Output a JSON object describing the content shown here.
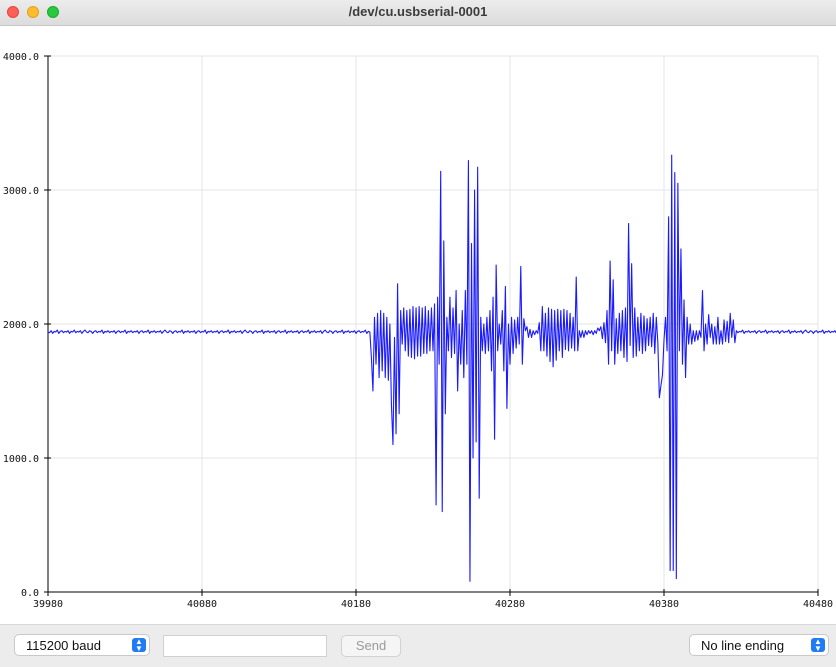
{
  "window": {
    "title": "/dev/cu.usbserial-0001"
  },
  "toolbar": {
    "baud_label": "115200 baud",
    "message_value": "",
    "send_label": "Send",
    "line_ending_label": "No line ending"
  },
  "colors": {
    "series": "#1a1aff",
    "grid": "#e6e6e6",
    "axis": "#000000"
  },
  "icons": {
    "stepper": "up-down-chevrons-icon"
  },
  "chart_data": {
    "type": "line",
    "title": "",
    "xlabel": "",
    "ylabel": "",
    "xlim": [
      39980,
      40480
    ],
    "ylim": [
      0,
      4000
    ],
    "x_ticks": [
      39980,
      40080,
      40180,
      40280,
      40380,
      40480
    ],
    "y_ticks": [
      "0.0",
      "1000.0",
      "2000.0",
      "3000.0",
      "4000.0"
    ],
    "grid": true,
    "legend": "none",
    "series": [
      {
        "x_start": 39980,
        "x_step": 1,
        "values": [
          1940,
          1935,
          1950,
          1930,
          1945,
          1940,
          1955,
          1930,
          1945,
          1950,
          1935,
          1945,
          1940,
          1950,
          1930,
          1945,
          1940,
          1955,
          1935,
          1945,
          1940,
          1950,
          1930,
          1945,
          1955,
          1940,
          1935,
          1950,
          1945,
          1930,
          1945,
          1950,
          1935,
          1945,
          1940,
          1955,
          1930,
          1945,
          1940,
          1950,
          1935,
          1945,
          1940,
          1950,
          1930,
          1945,
          1950,
          1935,
          1945,
          1940,
          1955,
          1930,
          1945,
          1940,
          1950,
          1935,
          1945,
          1940,
          1950,
          1930,
          1945,
          1950,
          1935,
          1945,
          1940,
          1955,
          1930,
          1945,
          1940,
          1950,
          1935,
          1945,
          1940,
          1950,
          1930,
          1945,
          1955,
          1940,
          1935,
          1950,
          1945,
          1930,
          1945,
          1950,
          1935,
          1945,
          1940,
          1955,
          1930,
          1945,
          1940,
          1950,
          1935,
          1945,
          1940,
          1950,
          1930,
          1945,
          1950,
          1935,
          1945,
          1940,
          1955,
          1930,
          1945,
          1940,
          1950,
          1935,
          1945,
          1940,
          1950,
          1930,
          1945,
          1950,
          1935,
          1945,
          1940,
          1955,
          1930,
          1945,
          1940,
          1950,
          1935,
          1945,
          1940,
          1950,
          1930,
          1945,
          1955,
          1940,
          1935,
          1950,
          1945,
          1930,
          1945,
          1950,
          1935,
          1945,
          1940,
          1955,
          1930,
          1945,
          1940,
          1950,
          1935,
          1945,
          1940,
          1950,
          1930,
          1945,
          1950,
          1935,
          1945,
          1940,
          1955,
          1930,
          1945,
          1940,
          1950,
          1935,
          1945,
          1940,
          1950,
          1930,
          1945,
          1950,
          1935,
          1945,
          1940,
          1955,
          1930,
          1945,
          1940,
          1950,
          1935,
          1945,
          1940,
          1950,
          1930,
          1945,
          1955,
          1940,
          1935,
          1950,
          1945,
          1930,
          1945,
          1950,
          1935,
          1945,
          1940,
          1955,
          1930,
          1945,
          1940,
          1950,
          1935,
          1945,
          1940,
          1950,
          1930,
          1945,
          1950,
          1935,
          1945,
          1940,
          1955,
          1930,
          1945,
          1940,
          1950,
          1935,
          1945,
          1940,
          1950,
          1930,
          1945,
          1950,
          1935,
          1945,
          1940,
          1955,
          1930,
          1945,
          1940,
          1950,
          1935,
          1945,
          1940,
          1950,
          1930,
          1945,
          1955,
          1940,
          1935,
          1950,
          1945,
          1930,
          1945,
          1950,
          1935,
          1945,
          1940,
          1955,
          1930,
          1945,
          1940,
          1950,
          1935,
          1945,
          1940,
          1950,
          1930,
          1945,
          1950,
          1935,
          1945,
          1940,
          1955,
          1930,
          1945,
          1940,
          1950,
          1935,
          1945,
          1940,
          1950,
          1930,
          1945,
          1950,
          1935,
          1945,
          1940,
          1955,
          1930,
          1945,
          1940,
          1950,
          1935,
          1945,
          1940,
          1950,
          1930,
          1945,
          1955,
          1940,
          1935,
          1950,
          1945,
          1930,
          1945,
          1950,
          1935,
          1945,
          1940,
          1955,
          1930,
          1945,
          1940,
          1950,
          1935,
          1945,
          1940,
          1950,
          1930,
          1945,
          1950,
          1935,
          1945,
          1940,
          1955,
          1930,
          1945,
          1940,
          1950,
          1935,
          1945,
          1940,
          1950,
          1930,
          1945,
          1950,
          1935,
          1945,
          1940,
          1955,
          1930,
          1945,
          1940,
          1950,
          1935,
          1945,
          1940,
          1950,
          1930,
          1945,
          1955,
          1940,
          1935,
          1950,
          1945,
          1930,
          1945,
          1950,
          1935,
          1945,
          1940,
          1955,
          1930,
          1945,
          1940,
          1950,
          1935,
          1945,
          1940,
          1950,
          1930,
          1945,
          1950,
          1935,
          1945,
          1940,
          1955,
          1930,
          1945,
          1940,
          1950,
          1935,
          1945,
          1940,
          1950,
          1930,
          1945,
          1950,
          1935,
          1945,
          1940,
          1955,
          1930,
          1945,
          1940,
          1950,
          1935,
          1945,
          1940,
          1950,
          1930,
          1945,
          1955,
          1940,
          1935,
          1950,
          1945,
          1930,
          1945,
          1950,
          1935,
          1945,
          1940,
          1955,
          1930,
          1945,
          1940,
          1950,
          1935,
          1945,
          1940,
          1950,
          1930,
          1945,
          1950,
          1935,
          1945,
          1940,
          1955,
          1930,
          1945,
          1940,
          1950,
          1935,
          1945,
          1940,
          1950,
          1930,
          1945,
          1950,
          1935,
          1945,
          1940,
          1955,
          1930,
          1945,
          1940,
          1950,
          1935,
          1945,
          1940,
          1950,
          1930,
          1945,
          1955,
          1940,
          1935,
          1950,
          1945,
          1930,
          1945,
          1950,
          1935,
          1945,
          1940,
          1955,
          1930,
          1945,
          1940,
          1950,
          1935,
          1945,
          1940,
          1950,
          1930,
          1945,
          1950,
          1935,
          1945,
          1940,
          1955,
          1930,
          1945,
          1940,
          1950,
          1935,
          1945,
          1940,
          1950,
          1930,
          1945,
          1950,
          1935,
          1945,
          1940,
          1955,
          1930,
          1945,
          1940,
          1950,
          1935,
          1945,
          1940,
          1950,
          1930,
          1945,
          1955,
          1940,
          1935,
          1950,
          1945,
          1930,
          1945,
          1950,
          1935,
          1945,
          1940,
          1955,
          1930,
          1945,
          1940,
          1950,
          1935,
          1945,
          1940,
          1950,
          1930,
          1945,
          1950,
          1935,
          1945,
          1940,
          1955,
          1930,
          1945
        ]
      }
    ],
    "overrides": [
      [
        40190,
        1750
      ],
      [
        40191,
        1500
      ],
      [
        40192,
        2050
      ],
      [
        40193,
        1700
      ],
      [
        40194,
        2080
      ],
      [
        40195,
        1600
      ],
      [
        40196,
        2100
      ],
      [
        40197,
        1650
      ],
      [
        40198,
        2080
      ],
      [
        40199,
        1600
      ],
      [
        40200,
        2050
      ],
      [
        40201,
        1580
      ],
      [
        40202,
        2000
      ],
      [
        40203,
        1400
      ],
      [
        40204,
        1100
      ],
      [
        40205,
        1900
      ],
      [
        40206,
        1180
      ],
      [
        40207,
        2300
      ],
      [
        40208,
        1330
      ],
      [
        40209,
        2100
      ],
      [
        40210,
        1850
      ],
      [
        40211,
        2120
      ],
      [
        40212,
        1800
      ],
      [
        40213,
        2100
      ],
      [
        40214,
        1760
      ],
      [
        40215,
        2110
      ],
      [
        40216,
        1750
      ],
      [
        40217,
        2130
      ],
      [
        40218,
        1740
      ],
      [
        40219,
        2120
      ],
      [
        40220,
        1760
      ],
      [
        40221,
        2130
      ],
      [
        40222,
        1760
      ],
      [
        40223,
        2120
      ],
      [
        40224,
        1780
      ],
      [
        40225,
        2130
      ],
      [
        40226,
        1780
      ],
      [
        40227,
        2100
      ],
      [
        40228,
        1800
      ],
      [
        40229,
        2120
      ],
      [
        40230,
        1800
      ],
      [
        40231,
        2150
      ],
      [
        40232,
        650
      ],
      [
        40233,
        2200
      ],
      [
        40234,
        1700
      ],
      [
        40235,
        3140
      ],
      [
        40236,
        600
      ],
      [
        40237,
        2620
      ],
      [
        40238,
        1330
      ],
      [
        40239,
        2050
      ],
      [
        40240,
        1800
      ],
      [
        40241,
        2200
      ],
      [
        40242,
        1750
      ],
      [
        40243,
        2120
      ],
      [
        40244,
        1780
      ],
      [
        40245,
        2250
      ],
      [
        40246,
        1500
      ],
      [
        40247,
        2000
      ],
      [
        40248,
        1700
      ],
      [
        40249,
        2100
      ],
      [
        40250,
        1600
      ],
      [
        40251,
        2250
      ],
      [
        40252,
        1700
      ],
      [
        40253,
        3220
      ],
      [
        40254,
        80
      ],
      [
        40255,
        2600
      ],
      [
        40256,
        1000
      ],
      [
        40257,
        3000
      ],
      [
        40258,
        1120
      ],
      [
        40259,
        3170
      ],
      [
        40260,
        700
      ],
      [
        40261,
        2050
      ],
      [
        40262,
        1800
      ],
      [
        40263,
        2000
      ],
      [
        40264,
        1780
      ],
      [
        40265,
        2050
      ],
      [
        40266,
        1800
      ],
      [
        40267,
        2100
      ],
      [
        40268,
        1650
      ],
      [
        40269,
        2200
      ],
      [
        40270,
        1140
      ],
      [
        40271,
        2440
      ],
      [
        40272,
        1800
      ],
      [
        40273,
        2000
      ],
      [
        40274,
        1850
      ],
      [
        40275,
        2100
      ],
      [
        40276,
        1650
      ],
      [
        40277,
        2280
      ],
      [
        40278,
        1370
      ],
      [
        40279,
        2000
      ],
      [
        40280,
        1700
      ],
      [
        40281,
        2050
      ],
      [
        40282,
        1780
      ],
      [
        40283,
        2030
      ],
      [
        40284,
        1820
      ],
      [
        40285,
        2050
      ],
      [
        40286,
        1850
      ],
      [
        40287,
        2430
      ],
      [
        40288,
        1700
      ],
      [
        40289,
        2040
      ],
      [
        40290,
        1950
      ],
      [
        40291,
        1980
      ],
      [
        40292,
        1900
      ],
      [
        40293,
        1960
      ],
      [
        40294,
        1900
      ],
      [
        40295,
        1950
      ],
      [
        40296,
        1920
      ],
      [
        40297,
        1950
      ],
      [
        40298,
        1930
      ],
      [
        40299,
        2010
      ],
      [
        40300,
        1800
      ],
      [
        40301,
        2130
      ],
      [
        40302,
        1800
      ],
      [
        40303,
        2080
      ],
      [
        40304,
        1760
      ],
      [
        40305,
        2120
      ],
      [
        40306,
        1720
      ],
      [
        40307,
        2110
      ],
      [
        40308,
        1680
      ],
      [
        40309,
        2100
      ],
      [
        40310,
        1730
      ],
      [
        40311,
        2110
      ],
      [
        40312,
        1800
      ],
      [
        40313,
        2100
      ],
      [
        40314,
        1750
      ],
      [
        40315,
        2110
      ],
      [
        40316,
        1810
      ],
      [
        40317,
        2100
      ],
      [
        40318,
        1800
      ],
      [
        40319,
        2080
      ],
      [
        40320,
        1820
      ],
      [
        40321,
        2050
      ],
      [
        40322,
        1800
      ],
      [
        40323,
        2350
      ],
      [
        40324,
        1800
      ],
      [
        40325,
        1950
      ],
      [
        40326,
        1900
      ],
      [
        40327,
        1950
      ],
      [
        40328,
        1900
      ],
      [
        40329,
        1950
      ],
      [
        40330,
        1920
      ],
      [
        40331,
        1950
      ],
      [
        40332,
        1930
      ],
      [
        40333,
        1950
      ],
      [
        40334,
        1920
      ],
      [
        40335,
        1950
      ],
      [
        40336,
        1930
      ],
      [
        40337,
        1970
      ],
      [
        40338,
        1950
      ],
      [
        40339,
        1980
      ],
      [
        40340,
        1890
      ],
      [
        40341,
        2010
      ],
      [
        40342,
        1860
      ],
      [
        40343,
        2100
      ],
      [
        40344,
        1700
      ],
      [
        40345,
        2470
      ],
      [
        40346,
        1800
      ],
      [
        40347,
        2330
      ],
      [
        40348,
        1700
      ],
      [
        40349,
        2040
      ],
      [
        40350,
        1780
      ],
      [
        40351,
        2080
      ],
      [
        40352,
        1800
      ],
      [
        40353,
        2100
      ],
      [
        40354,
        1750
      ],
      [
        40355,
        2120
      ],
      [
        40356,
        1720
      ],
      [
        40357,
        2750
      ],
      [
        40358,
        1840
      ],
      [
        40359,
        2450
      ],
      [
        40360,
        1750
      ],
      [
        40361,
        2120
      ],
      [
        40362,
        1760
      ],
      [
        40363,
        2050
      ],
      [
        40364,
        1800
      ],
      [
        40365,
        2080
      ],
      [
        40366,
        1780
      ],
      [
        40367,
        2060
      ],
      [
        40368,
        1800
      ],
      [
        40369,
        2040
      ],
      [
        40370,
        1840
      ],
      [
        40371,
        2050
      ],
      [
        40372,
        1830
      ],
      [
        40373,
        2080
      ],
      [
        40374,
        1780
      ],
      [
        40375,
        2050
      ],
      [
        40376,
        1860
      ],
      [
        40377,
        1450
      ],
      [
        40378,
        1540
      ],
      [
        40379,
        1620
      ],
      [
        40380,
        1880
      ],
      [
        40381,
        2050
      ],
      [
        40382,
        1800
      ],
      [
        40383,
        2800
      ],
      [
        40384,
        160
      ],
      [
        40385,
        3260
      ],
      [
        40386,
        160
      ],
      [
        40387,
        3130
      ],
      [
        40388,
        100
      ],
      [
        40389,
        3050
      ],
      [
        40390,
        1800
      ],
      [
        40391,
        2560
      ],
      [
        40392,
        1700
      ],
      [
        40393,
        2180
      ],
      [
        40394,
        1600
      ],
      [
        40395,
        2050
      ],
      [
        40396,
        1850
      ],
      [
        40397,
        2000
      ],
      [
        40398,
        1850
      ],
      [
        40399,
        1950
      ],
      [
        40400,
        1870
      ],
      [
        40401,
        1950
      ],
      [
        40402,
        1880
      ],
      [
        40403,
        1950
      ],
      [
        40404,
        1900
      ],
      [
        40405,
        2250
      ],
      [
        40406,
        1800
      ],
      [
        40407,
        2000
      ],
      [
        40408,
        1850
      ],
      [
        40409,
        2070
      ],
      [
        40410,
        1900
      ],
      [
        40411,
        2000
      ],
      [
        40412,
        1850
      ],
      [
        40413,
        1980
      ],
      [
        40414,
        1850
      ],
      [
        40415,
        2050
      ],
      [
        40416,
        1850
      ],
      [
        40417,
        1950
      ],
      [
        40418,
        1850
      ],
      [
        40419,
        2030
      ],
      [
        40420,
        1870
      ],
      [
        40421,
        2020
      ],
      [
        40422,
        1860
      ],
      [
        40423,
        2080
      ],
      [
        40424,
        1900
      ],
      [
        40425,
        2030
      ],
      [
        40426,
        1860
      ],
      [
        40427,
        1950
      ]
    ]
  }
}
